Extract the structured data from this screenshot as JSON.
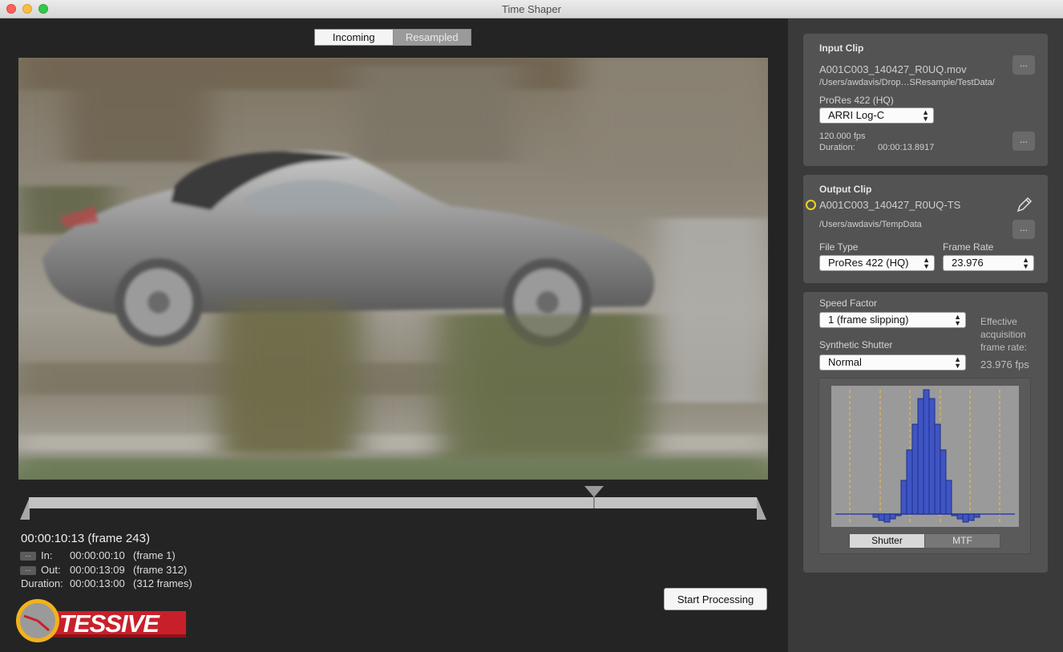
{
  "window": {
    "title": "Time Shaper"
  },
  "viewer": {
    "tabs": [
      "Incoming",
      "Resampled"
    ],
    "active_tab": "Resampled"
  },
  "timeline": {
    "current_timecode": "00:00:10:13",
    "current_frame": "(frame 243)",
    "in_button": "...",
    "in_label": "In:",
    "in_timecode": "00:00:00:10",
    "in_frame": "(frame 1)",
    "out_button": "...",
    "out_label": "Out:",
    "out_timecode": "00:00:13:09",
    "out_frame": "(frame 312)",
    "duration_label": "Duration:",
    "duration_timecode": "00:00:13:00",
    "duration_frames": "(312 frames)",
    "playhead_progress": 0.78
  },
  "actions": {
    "start_processing": "Start Processing"
  },
  "logo": {
    "text": "TESSIVE"
  },
  "input_clip": {
    "title": "Input Clip",
    "filename": "A001C003_140427_R0UQ.mov",
    "path": "/Users/awdavis/Drop…SResample/TestData/",
    "codec": "ProRes 422 (HQ)",
    "color_space": "ARRI Log-C",
    "fps": "120.000 fps",
    "duration_label": "Duration:",
    "duration": "00:00:13.8917",
    "browse_button": "...",
    "settings_button": "..."
  },
  "output_clip": {
    "title": "Output Clip",
    "name": "A001C003_140427_R0UQ-TS",
    "path": "/Users/awdavis/TempData",
    "browse_button": "...",
    "file_type_label": "File Type",
    "file_type": "ProRes 422 (HQ)",
    "frame_rate_label": "Frame Rate",
    "frame_rate": "23.976"
  },
  "shutter": {
    "speed_factor_label": "Speed Factor",
    "speed_factor": "1 (frame slipping)",
    "synthetic_shutter_label": "Synthetic Shutter",
    "synthetic_shutter": "Normal",
    "effective_label_1": "Effective",
    "effective_label_2": "acquisition",
    "effective_label_3": "frame rate:",
    "effective_rate": "23.976 fps",
    "graph_tabs": [
      "Shutter",
      "MTF"
    ],
    "active_graph_tab": "Shutter"
  },
  "colors": {
    "window_bg": "#242424",
    "sidebar_bg": "#3a3a3a",
    "panel_bg": "#535353",
    "histogram_fill": "#3f55c4",
    "histogram_stroke": "#1f2d86",
    "guide_line": "#f0c040",
    "logo_red": "#c8202a"
  },
  "icons": [
    "close-icon",
    "minimize-icon",
    "zoom-icon",
    "pencil-icon",
    "status-circle-icon",
    "stepper-arrows-icon",
    "clock-logo-icon"
  ]
}
